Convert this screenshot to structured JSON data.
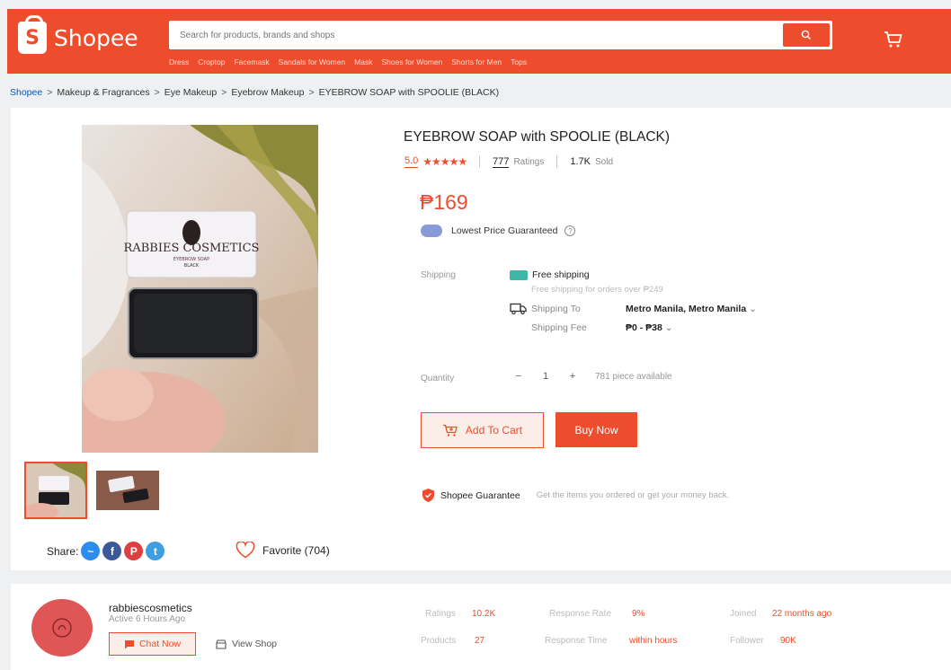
{
  "brand": {
    "name": "Shopee",
    "accent": "#ee4d2d"
  },
  "search": {
    "placeholder": "Search for products, brands and shops"
  },
  "hotwords": [
    "Dress",
    "Croptop",
    "Facemask",
    "Sandals for Women",
    "Mask",
    "Shoes for Women",
    "Shorts for Men",
    "Tops"
  ],
  "breadcrumb": [
    "Shopee",
    "Makeup & Fragrances",
    "Eye Makeup",
    "Eyebrow Makeup",
    "EYEBROW SOAP with SPOOLIE (BLACK)"
  ],
  "product": {
    "title": "EYEBROW SOAP with SPOOLIE (BLACK)",
    "rating": "5.0",
    "stars": "★★★★★",
    "rating_count": "777",
    "rating_label": "Ratings",
    "sold_count": "1.7K",
    "sold_label": "Sold",
    "price": "₱169",
    "lowest_price": "Lowest Price Guaranteed",
    "image_brand_text": "RABBIES COSMETICS",
    "image_sub_text": "EYEBROW SOAP",
    "image_sub_text2": "BLACK"
  },
  "shipping": {
    "label": "Shipping",
    "free_title": "Free shipping",
    "free_sub": "Free shipping for orders over ₱249",
    "to_label": "Shipping To",
    "to_value": "Metro Manila, Metro Manila",
    "fee_label": "Shipping Fee",
    "fee_value": "₱0 - ₱38"
  },
  "quantity": {
    "label": "Quantity",
    "minus": "−",
    "value": "1",
    "plus": "+",
    "available": "781 piece available"
  },
  "buttons": {
    "add_to_cart": "Add To Cart",
    "buy_now": "Buy Now"
  },
  "guarantee": {
    "title": "Shopee Guarantee",
    "desc": "Get the items you ordered or get your money back."
  },
  "share": {
    "label": "Share:",
    "icons": [
      "messenger-icon",
      "facebook-icon",
      "pinterest-icon",
      "twitter-icon"
    ]
  },
  "favorite": {
    "label": "Favorite (704)"
  },
  "shop": {
    "name": "rabbiescosmetics",
    "active": "Active 6 Hours Ago",
    "chat": "Chat Now",
    "view": "View Shop",
    "stats": {
      "ratings_label": "Ratings",
      "ratings_value": "10.2K",
      "products_label": "Products",
      "products_value": "27",
      "response_rate_label": "Response Rate",
      "response_rate_value": "9%",
      "response_time_label": "Response Time",
      "response_time_value": "within hours",
      "joined_label": "Joined",
      "joined_value": "22 months ago",
      "follower_label": "Follower",
      "follower_value": "90K"
    }
  }
}
